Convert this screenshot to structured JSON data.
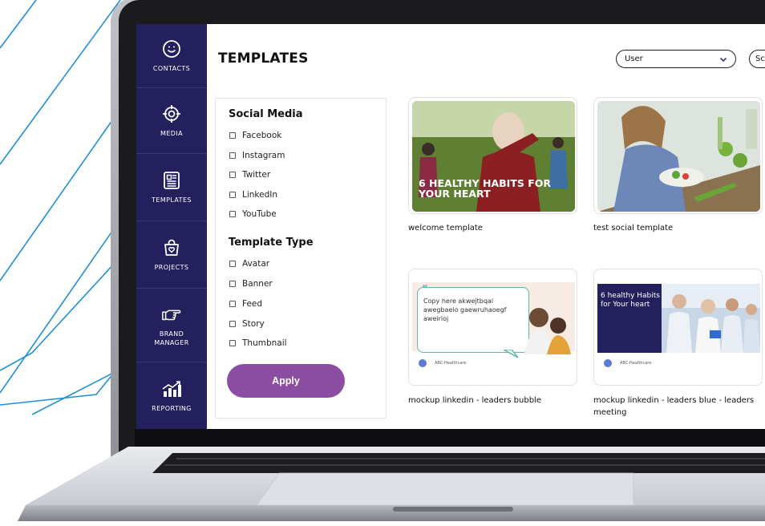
{
  "nav": {
    "items": [
      {
        "label": "CONTACTS",
        "icon": "smiley-icon"
      },
      {
        "label": "MEDIA",
        "icon": "target-icon"
      },
      {
        "label": "TEMPLATES",
        "icon": "newspaper-icon"
      },
      {
        "label": "PROJECTS",
        "icon": "heart-bag-icon"
      },
      {
        "label": "BRAND MANAGER",
        "icon": "pointing-hand-icon"
      },
      {
        "label": "REPORTING",
        "icon": "bar-chart-icon"
      }
    ]
  },
  "header": {
    "title": "TEMPLATES",
    "user_select_value": "User",
    "search_partial": "Sc"
  },
  "filters": {
    "social_media_title": "Social Media",
    "social_media": [
      "Facebook",
      "Instagram",
      "Twitter",
      "LinkedIn",
      "YouTube"
    ],
    "template_type_title": "Template Type",
    "template_type": [
      "Avatar",
      "Banner",
      "Feed",
      "Story",
      "Thumbnail"
    ],
    "apply_label": "Apply"
  },
  "templates": [
    {
      "label": "welcome template",
      "overlay_text": "6 HEALTHY HABITS FOR YOUR HEART"
    },
    {
      "label": "test social template"
    },
    {
      "label": "mockup linkedin - leaders bubble",
      "bubble_text": "Copy here akwejtbqai awegbaeio gaewruhaoegf aweirioj",
      "brand": "ABC-Healthcare"
    },
    {
      "label": "mockup linkedin - leaders blue - leaders meeting",
      "panel_text": "6 healthy Habits for Your heart",
      "brand": "ABC-Healthcare"
    }
  ],
  "colors": {
    "nav_bg": "#24205e",
    "apply_bg": "#8c4ea3",
    "deco_line": "#1e8fd6"
  }
}
